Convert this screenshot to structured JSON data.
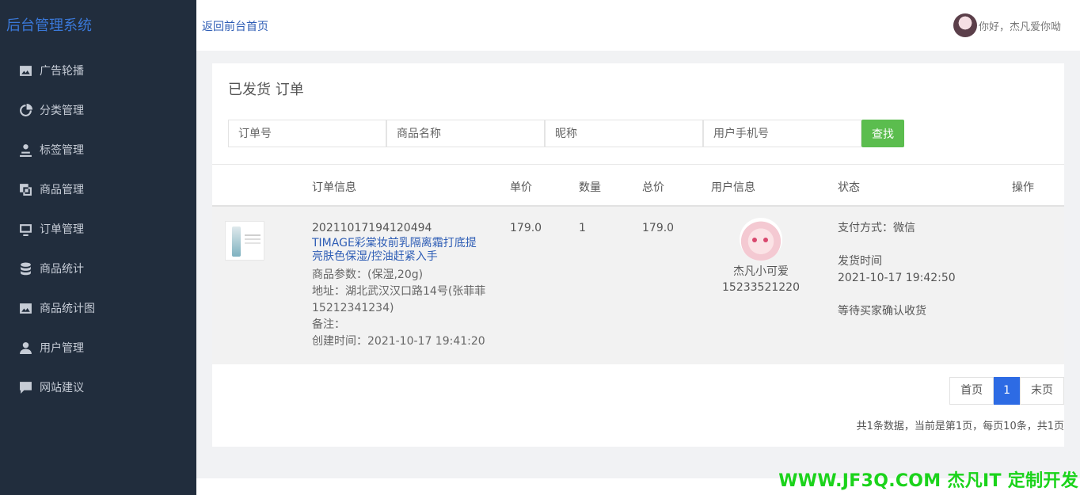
{
  "app": {
    "title": "后台管理系统"
  },
  "sidebar": {
    "items": [
      {
        "label": "广告轮播",
        "icon": "image-icon"
      },
      {
        "label": "分类管理",
        "icon": "pie-chart-icon"
      },
      {
        "label": "标签管理",
        "icon": "person-tag-icon"
      },
      {
        "label": "商品管理",
        "icon": "copy-icon"
      },
      {
        "label": "订单管理",
        "icon": "monitor-icon"
      },
      {
        "label": "商品统计",
        "icon": "database-icon"
      },
      {
        "label": "商品统计图",
        "icon": "image-icon"
      },
      {
        "label": "用户管理",
        "icon": "user-icon"
      },
      {
        "label": "网站建议",
        "icon": "chat-icon"
      }
    ]
  },
  "topbar": {
    "back_link": "返回前台首页",
    "greeting": "你好，杰凡爱你呦"
  },
  "page": {
    "title": "已发货 订单"
  },
  "search": {
    "order_no_placeholder": "订单号",
    "product_name_placeholder": "商品名称",
    "nickname_placeholder": "昵称",
    "phone_placeholder": "用户手机号",
    "button": "查找"
  },
  "table": {
    "headers": {
      "order_info": "订单信息",
      "unit_price": "单价",
      "quantity": "数量",
      "total": "总价",
      "user_info": "用户信息",
      "status": "状态",
      "action": "操作"
    },
    "rows": [
      {
        "order_no": "20211017194120494",
        "product_name": "TIMAGE彩棠妆前乳隔离霜打底提亮肤色保湿/控油赶紧入手",
        "params": "商品参数：(保湿,20g)",
        "address": "地址：湖北武汉汉口路14号(张菲菲15212341234)",
        "remark": "备注：",
        "created": "创建时间：2021-10-17 19:41:20",
        "unit_price": "179.0",
        "quantity": "1",
        "total": "179.0",
        "user_name": "杰凡小可爱",
        "user_phone": "15233521220",
        "payment": "支付方式：微信",
        "ship_label": "发货时间",
        "ship_time": "2021-10-17 19:42:50",
        "status": "等待买家确认收货"
      }
    ]
  },
  "pagination": {
    "first": "首页",
    "current": "1",
    "last": "末页",
    "info": "共1条数据，当前是第1页，每页10条，共1页"
  },
  "watermark": {
    "brand": "WWW.JF3Q.COM 杰凡IT   定制开发",
    "color": "#1bd31b"
  },
  "colors": {
    "sidebar_bg": "#212d3d",
    "accent_blue": "#2d6be4",
    "search_green": "#5bbd4e"
  }
}
